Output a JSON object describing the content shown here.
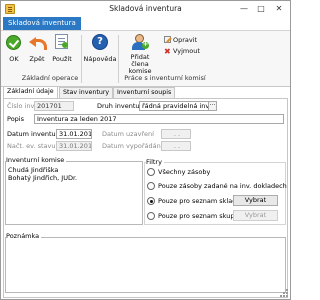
{
  "window": {
    "title": "Skladová inventura",
    "controls": {
      "minimize": "—",
      "maximize": "□",
      "close": "✕"
    }
  },
  "ribbon": {
    "tab_label": "Skladová inventura",
    "groups": [
      {
        "label": "Základní operace"
      },
      {
        "label": "Práce s inventurní komisí"
      }
    ],
    "buttons": {
      "ok": "OK",
      "back": "Zpět",
      "use": "Použít",
      "help": "Nápověda",
      "add_member": "Přidat člena komise",
      "edit": "Opravit",
      "remove": "Vyjmout"
    }
  },
  "tabs": [
    {
      "label": "Základní údaje",
      "active": true
    },
    {
      "label": "Stav inventury",
      "active": false
    },
    {
      "label": "Inventurní soupis",
      "active": false
    }
  ],
  "form": {
    "cislo_label": "Číslo inv.",
    "cislo_value": "201701",
    "druh_label": "Druh inventury",
    "druh_value": "řádná pravidelná inventu",
    "druh_button": "···",
    "popis_label": "Popis",
    "popis_value": "Inventura za leden 2017",
    "datum_inv_label": "Datum inventury:",
    "datum_inv_value": "31.01.2017",
    "datum_uzavreni_label": "Datum uzavření",
    "datum_uzavreni_value": ". .",
    "nacteni_label": "Načt. ev. stavu:",
    "nacteni_value": "31.01.2017",
    "datum_vysporadani_label": "Datum vypořádání:",
    "datum_vysporadani_value": ". ."
  },
  "komise": {
    "title": "Inventurní komise",
    "members": [
      "Chudá Jindřiška",
      "Bohatý Jindřich, JUDr."
    ]
  },
  "filtry": {
    "title": "Filtry",
    "options": [
      {
        "label": "Všechny zásoby",
        "selected": false
      },
      {
        "label": "Pouze zásoby zadané na inv. dokladech",
        "selected": false
      },
      {
        "label": "Pouze pro seznam skladů",
        "selected": true
      },
      {
        "label": "Pouze pro seznam skupin",
        "selected": false
      }
    ],
    "vybrat_1": "Vybrat",
    "vybrat_2": "Vybrat"
  },
  "poznamka": {
    "title": "Poznámka",
    "value": ""
  }
}
